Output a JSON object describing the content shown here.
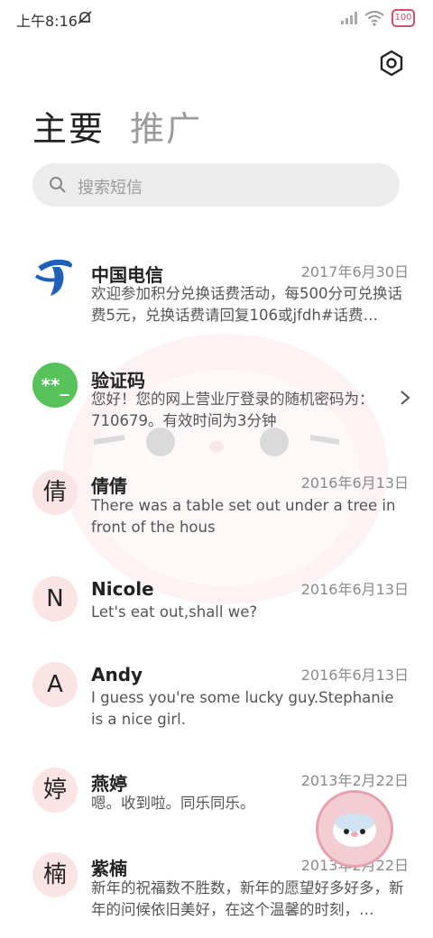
{
  "status": {
    "time": "上午8:16",
    "battery": "100"
  },
  "tabs": {
    "main": "主要",
    "promo": "推广"
  },
  "search": {
    "placeholder": "搜索短信"
  },
  "conversations": [
    {
      "name": "中国电信",
      "date": "2017年6月30日",
      "preview": "欢迎参加积分兑换话费活动，每500分可兑换话费5元，兑换话费请回复106或jfdh#话费…",
      "avatar": "telecom-logo"
    },
    {
      "name": "验证码",
      "date": "",
      "preview": "您好！您的网上营业厅登录的随机密码为：710679。有效时间为3分钟",
      "avatar_text": "**_",
      "avatar_color": "#58c25a"
    },
    {
      "name": "倩倩",
      "date": "2016年6月13日",
      "preview": "There was a table set out under a tree in front of the hous",
      "avatar_text": "倩"
    },
    {
      "name": "Nicole",
      "date": "2016年6月13日",
      "preview": "Let's eat out,shall we?",
      "avatar_text": "N"
    },
    {
      "name": "Andy",
      "date": "2016年6月13日",
      "preview": "I guess you're some lucky guy.Stephanie is a nice girl.",
      "avatar_text": "A"
    },
    {
      "name": "燕婷",
      "date": "2013年2月22日",
      "preview": "嗯。收到啦。同乐同乐。",
      "avatar_text": "婷"
    },
    {
      "name": "紫楠",
      "date": "2013年2月22日",
      "preview": "新年的祝福数不胜数，新年的愿望好多好多，新年的问候依旧美好，在这个温馨的时刻，…",
      "avatar_text": "楠"
    }
  ],
  "colors": {
    "avatar_bg": "#fbe4e6",
    "accent": "#d05070"
  }
}
